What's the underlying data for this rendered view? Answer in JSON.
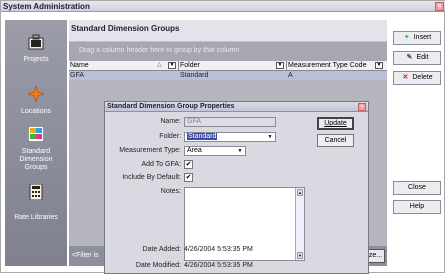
{
  "window": {
    "title": "System Administration",
    "close": "×"
  },
  "nav": {
    "items": [
      {
        "label": "Projects",
        "icon": "briefcase-icon"
      },
      {
        "label": "Locations",
        "icon": "compass-icon"
      },
      {
        "label": "Standard Dimension Groups",
        "line1": "Standard",
        "line2": "Dimension",
        "line3": "Groups",
        "icon": "dimension-groups-icon"
      },
      {
        "label": "Rate Libraries",
        "icon": "rate-library-icon"
      }
    ]
  },
  "panel": {
    "title": "Standard Dimension Groups",
    "group_hint": "Drag a column header here to group by that column",
    "columns": [
      "Name",
      "Folder",
      "Measurement Type Code"
    ],
    "rows": [
      {
        "name": "GFA",
        "folder": "Standard",
        "code": "A"
      }
    ],
    "filter_text": "<Filter is",
    "filter_button": "ze..."
  },
  "actions": {
    "insert": "Insert",
    "edit": "Edit",
    "delete": "Delete",
    "close": "Close",
    "help": "Help"
  },
  "dialog": {
    "title": "Standard Dimension Group Properties",
    "close": "×",
    "labels": {
      "name": "Name:",
      "folder": "Folder:",
      "measurement_type": "Measurement Type:",
      "add_to_gfa": "Add To GFA:",
      "include_by_default": "Include By Default:",
      "notes": "Notes:",
      "date_added": "Date Added:",
      "date_modified": "Date Modified:"
    },
    "values": {
      "name": "GFA",
      "folder": "Standard",
      "measurement_type": "Area",
      "add_to_gfa": "✔",
      "include_by_default": "✔",
      "notes": "",
      "date_added": "4/26/2004 5:53:35 PM",
      "date_modified": "4/26/2004 5:53:35 PM"
    },
    "buttons": {
      "update": "Update",
      "cancel": "Cancel"
    }
  }
}
